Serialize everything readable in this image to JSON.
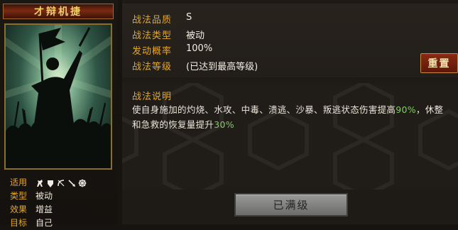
{
  "skill": {
    "name": "才辩机捷",
    "stats": {
      "apply_label": "适用",
      "troop_icons": [
        "cavalry-icon",
        "shield-icon",
        "bow-icon",
        "spear-icon",
        "ship-wheel-icon"
      ],
      "type_label": "类型",
      "type_value": "被动",
      "effect_label": "效果",
      "effect_value": "增益",
      "target_label": "目标",
      "target_value": "自己"
    }
  },
  "info": {
    "quality_label": "战法品质",
    "quality_value": "S",
    "category_label": "战法类型",
    "category_value": "被动",
    "rate_label": "发动概率",
    "rate_value": "100%",
    "level_label": "战法等级",
    "level_value": "(已达到最高等级)"
  },
  "buttons": {
    "reset": "重置",
    "max_level": "已满级"
  },
  "description": {
    "title": "战法说明",
    "part1": "使自身施加的灼烧、水攻、中毒、溃逃、沙暴、叛逃状态伤害提高",
    "pct1": "90%",
    "part2": "，休整和急救的恢复量提升",
    "pct2": "30%"
  },
  "colors": {
    "label_gold": "#e6a72a",
    "highlight_green": "#7ed05a",
    "title_red": "#7a2a12"
  }
}
